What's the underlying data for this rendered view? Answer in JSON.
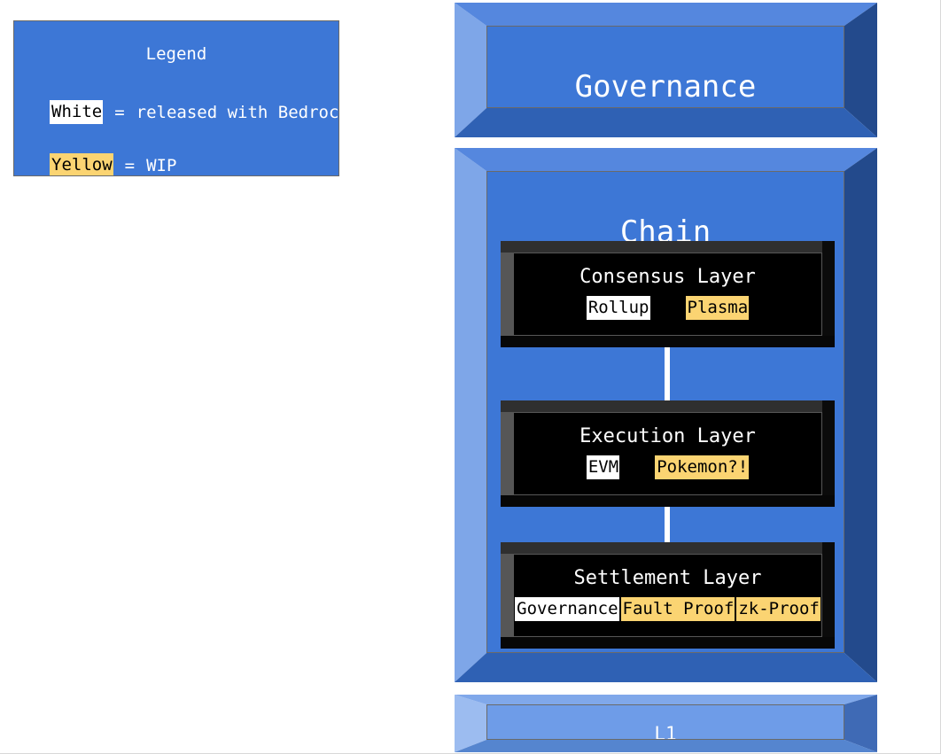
{
  "legend": {
    "title": "Legend",
    "rows": [
      {
        "tag": "White",
        "style": "white",
        "separator": "=",
        "description": "released with Bedrock"
      },
      {
        "tag": "Yellow",
        "style": "yellow",
        "separator": "=",
        "description": "WIP"
      }
    ]
  },
  "governance": {
    "title": "Governance"
  },
  "chain": {
    "title": "Chain",
    "layers": [
      {
        "title": "Consensus Layer",
        "tags": [
          {
            "label": "Rollup",
            "style": "white"
          },
          {
            "label": "Plasma",
            "style": "yellow"
          }
        ]
      },
      {
        "title": "Execution Layer",
        "tags": [
          {
            "label": "EVM",
            "style": "white"
          },
          {
            "label": "Pokemon?!",
            "style": "yellow"
          }
        ]
      },
      {
        "title": "Settlement Layer",
        "tags": [
          {
            "label": "Governance",
            "style": "white"
          },
          {
            "label": "Fault Proof",
            "style": "yellow"
          },
          {
            "label": "zk-Proof",
            "style": "yellow"
          }
        ]
      }
    ]
  },
  "l1": {
    "title": "L1"
  },
  "colors": {
    "panel_blue": "#3d77d6",
    "bevel_light_blue": "#7ea6e8",
    "bevel_dark_blue": "#234a8c",
    "l1_blue": "#6e9ce8",
    "tag_white": "#ffffff",
    "tag_yellow": "#fbd472",
    "layer_black": "#000000",
    "connector_white": "#ffffff",
    "text_white": "#ffffff",
    "text_black": "#000000"
  }
}
